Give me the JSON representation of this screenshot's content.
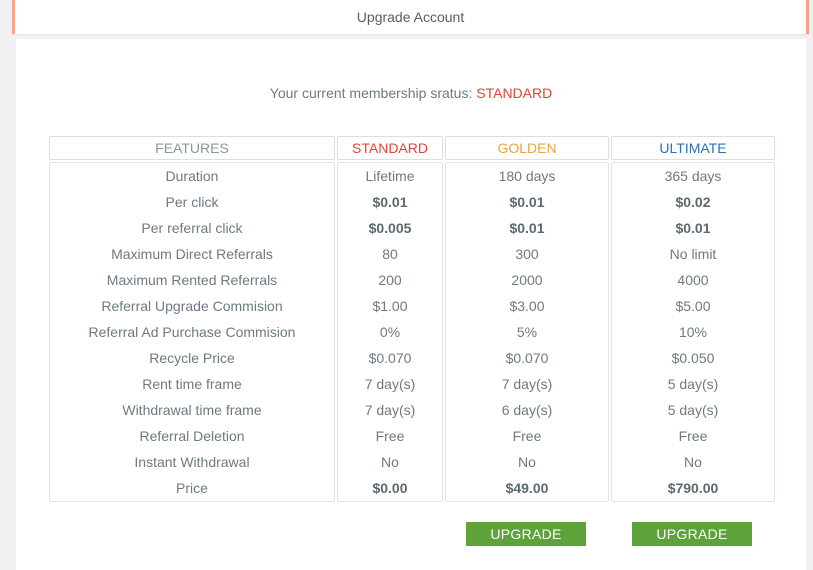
{
  "header": {
    "title": "Upgrade Account"
  },
  "status": {
    "label": "Your current membership sratus:",
    "value": "STANDARD"
  },
  "table": {
    "headers": {
      "features": "FEATURES",
      "standard": "STANDARD",
      "golden": "GOLDEN",
      "ultimate": "ULTIMATE"
    },
    "header_colors": {
      "standard": "#e0443a",
      "golden": "#e9a53b",
      "ultimate": "#2d6fb7"
    },
    "rows": [
      {
        "feature": "Duration",
        "standard": "Lifetime",
        "golden": "180 days",
        "ultimate": "365 days",
        "bold": false
      },
      {
        "feature": "Per click",
        "standard": "$0.01",
        "golden": "$0.01",
        "ultimate": "$0.02",
        "bold": true
      },
      {
        "feature": "Per referral click",
        "standard": "$0.005",
        "golden": "$0.01",
        "ultimate": "$0.01",
        "bold": true
      },
      {
        "feature": "Maximum Direct Referrals",
        "standard": "80",
        "golden": "300",
        "ultimate": "No limit",
        "bold": false
      },
      {
        "feature": "Maximum Rented Referrals",
        "standard": "200",
        "golden": "2000",
        "ultimate": "4000",
        "bold": false
      },
      {
        "feature": "Referral Upgrade Commision",
        "standard": "$1.00",
        "golden": "$3.00",
        "ultimate": "$5.00",
        "bold": false
      },
      {
        "feature": "Referral Ad Purchase Commision",
        "standard": "0%",
        "golden": "5%",
        "ultimate": "10%",
        "bold": false
      },
      {
        "feature": "Recycle Price",
        "standard": "$0.070",
        "golden": "$0.070",
        "ultimate": "$0.050",
        "bold": false
      },
      {
        "feature": "Rent time frame",
        "standard": "7 day(s)",
        "golden": "7 day(s)",
        "ultimate": "5 day(s)",
        "bold": false
      },
      {
        "feature": "Withdrawal time frame",
        "standard": "7 day(s)",
        "golden": "6 day(s)",
        "ultimate": "5 day(s)",
        "bold": false
      },
      {
        "feature": "Referral Deletion",
        "standard": "Free",
        "golden": "Free",
        "ultimate": "Free",
        "bold": false
      },
      {
        "feature": "Instant Withdrawal",
        "standard": "No",
        "golden": "No",
        "ultimate": "No",
        "bold": false
      },
      {
        "feature": "Price",
        "standard": "$0.00",
        "golden": "$49.00",
        "ultimate": "$790.00",
        "bold": true
      }
    ]
  },
  "buttons": {
    "upgrade_golden": "UPGRADE",
    "upgrade_ultimate": "UPGRADE",
    "color": "#5ea33a"
  }
}
